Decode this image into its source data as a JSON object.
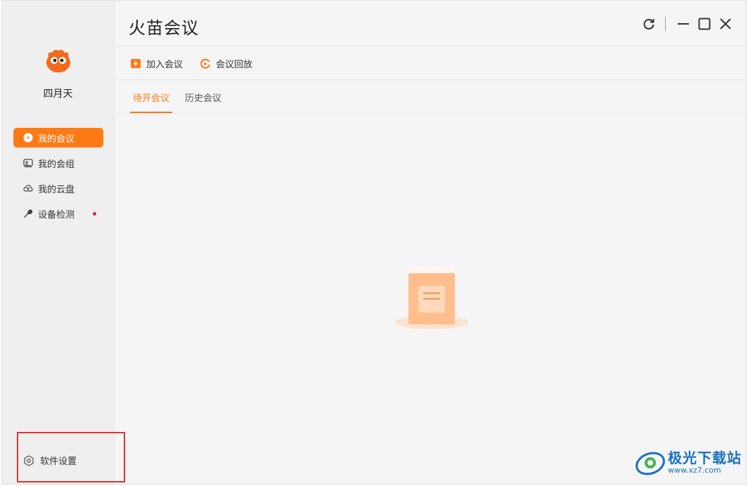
{
  "app": {
    "title": "火苗会议"
  },
  "user": {
    "name": "四月天"
  },
  "sidebar": {
    "items": [
      {
        "label": "我的会议",
        "icon": "meeting-icon",
        "active": true
      },
      {
        "label": "我的会组",
        "icon": "group-icon",
        "active": false
      },
      {
        "label": "我的云盘",
        "icon": "cloud-upload-icon",
        "active": false
      },
      {
        "label": "设备检测",
        "icon": "wrench-icon",
        "active": false,
        "badge": "red-dot"
      }
    ],
    "settings_label": "软件设置"
  },
  "toolbar": {
    "join_label": "加入会议",
    "replay_label": "会议回放"
  },
  "tabs": [
    {
      "label": "待开会议",
      "active": true
    },
    {
      "label": "历史会议",
      "active": false
    }
  ],
  "watermark": {
    "name": "极光下载站",
    "url": "www.xz7.com"
  },
  "colors": {
    "accent": "#ff7a14",
    "sidebar_bg": "#efefef",
    "main_bg": "#f5f5f5",
    "highlight": "#e53030"
  }
}
